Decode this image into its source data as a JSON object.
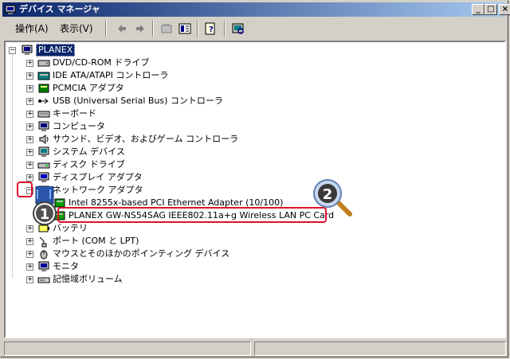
{
  "window": {
    "title": "デバイス マネージャ",
    "buttons": {
      "minimize": "_",
      "maximize": "□",
      "close": "×"
    }
  },
  "menu": {
    "action": "操作(A)",
    "view": "表示(V)"
  },
  "toolbar": [
    "back-icon",
    "forward-icon",
    "properties-icon",
    "tree-icon",
    "help-icon",
    "scan-icon"
  ],
  "tree": {
    "root": "PLANEX",
    "items": [
      {
        "label": "DVD/CD-ROM ドライブ",
        "icon": "dvd-drive-icon"
      },
      {
        "label": "IDE ATA/ATAPI コントローラ",
        "icon": "ide-controller-icon"
      },
      {
        "label": "PCMCIA アダプタ",
        "icon": "pcmcia-icon"
      },
      {
        "label": "USB (Universal Serial Bus) コントローラ",
        "icon": "usb-icon"
      },
      {
        "label": "キーボード",
        "icon": "keyboard-icon"
      },
      {
        "label": "コンピュータ",
        "icon": "computer-icon"
      },
      {
        "label": "サウンド、ビデオ、およびゲーム コントローラ",
        "icon": "sound-icon"
      },
      {
        "label": "システム デバイス",
        "icon": "system-device-icon"
      },
      {
        "label": "ディスク ドライブ",
        "icon": "disk-drive-icon"
      },
      {
        "label": "ディスプレイ アダプタ",
        "icon": "display-adapter-icon"
      },
      {
        "label": "ネットワーク アダプタ",
        "icon": "network-adapter-icon",
        "expanded": true,
        "children": [
          {
            "label": "Intel 8255x-based PCI Ethernet Adapter (10/100)"
          },
          {
            "label": "PLANEX GW-NS54SAG IEEE802.11a+g Wireless LAN PC Card"
          }
        ]
      },
      {
        "label": "バッテリ",
        "icon": "battery-icon"
      },
      {
        "label": "ポート (COM と LPT)",
        "icon": "port-icon"
      },
      {
        "label": "マウスとそのほかのポインティング デバイス",
        "icon": "mouse-icon"
      },
      {
        "label": "モニタ",
        "icon": "monitor-icon"
      },
      {
        "label": "記憶域ボリューム",
        "icon": "volume-icon"
      }
    ]
  },
  "annotations": {
    "badge1": "1",
    "badge2": "2"
  },
  "colors": {
    "title_start": "#0a246a",
    "title_end": "#a6caf0",
    "callout": "#e0102a",
    "badge_fill": "#2a55a8"
  }
}
